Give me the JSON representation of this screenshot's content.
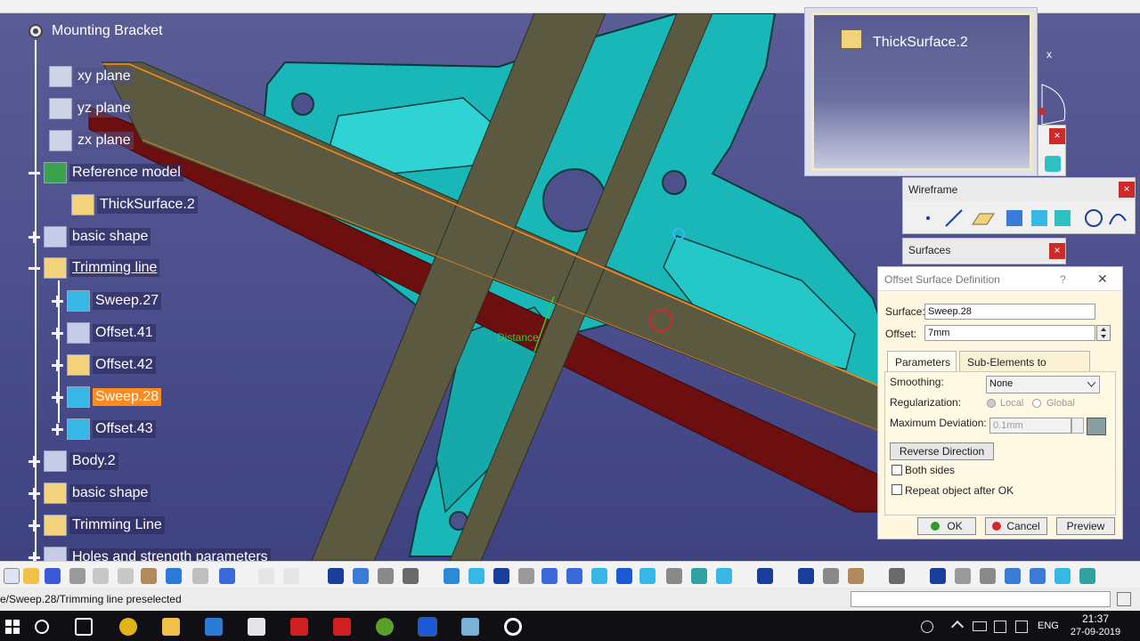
{
  "spec_tree": {
    "root": "Mounting Bracket",
    "items": [
      {
        "label": "xy plane",
        "kind": "plane"
      },
      {
        "label": "yz plane",
        "kind": "plane"
      },
      {
        "label": "zx plane",
        "kind": "plane"
      },
      {
        "label": "Reference model",
        "kind": "set"
      },
      {
        "label": "ThickSurface.2",
        "kind": "feature"
      },
      {
        "label": "basic shape",
        "kind": "set"
      },
      {
        "label": "Trimming line",
        "kind": "set"
      },
      {
        "label": "Sweep.27",
        "kind": "feature"
      },
      {
        "label": "Offset.41",
        "kind": "feature"
      },
      {
        "label": "Offset.42",
        "kind": "feature"
      },
      {
        "label": "Sweep.28",
        "kind": "feature",
        "selected": true
      },
      {
        "label": "Offset.43",
        "kind": "feature"
      },
      {
        "label": "Body.2",
        "kind": "body"
      },
      {
        "label": "basic shape",
        "kind": "set"
      },
      {
        "label": "Trimming Line",
        "kind": "set"
      },
      {
        "label": "Holes and strength parameters",
        "kind": "set"
      }
    ]
  },
  "viewport": {
    "distance_label": "Distance",
    "compass_axis": "x"
  },
  "thick_surface_window": {
    "label": "ThickSurface.2"
  },
  "toolbars": {
    "wireframe": {
      "title": "Wireframe"
    },
    "surfaces": {
      "title": "Surfaces"
    },
    "close_glyph": "×"
  },
  "dialog": {
    "title": "Offset Surface Definition",
    "help_glyph": "?",
    "close_glyph": "✕",
    "surface_label": "Surface:",
    "surface_value": "Sweep.28",
    "offset_label": "Offset:",
    "offset_value": "7mm",
    "tabs": [
      "Parameters",
      "Sub-Elements to remove"
    ],
    "smoothing_label": "Smoothing:",
    "smoothing_value": "None",
    "regularization_label": "Regularization:",
    "reg_local": "Local",
    "reg_global": "Global",
    "max_dev_label": "Maximum Deviation:",
    "max_dev_value": "0.1mm",
    "reverse_button": "Reverse Direction",
    "both_sides": "Both sides",
    "repeat_object": "Repeat object after OK",
    "ok": "OK",
    "cancel": "Cancel",
    "preview": "Preview",
    "colors": {
      "ok_green": "#2e9a2e",
      "cancel_red": "#cc2a2a"
    }
  },
  "status": {
    "text": "e/Sweep.28/Trimming line preselected"
  },
  "taskbar": {
    "lang": "ENG",
    "time": "21:37",
    "date": "27-09-2019"
  }
}
